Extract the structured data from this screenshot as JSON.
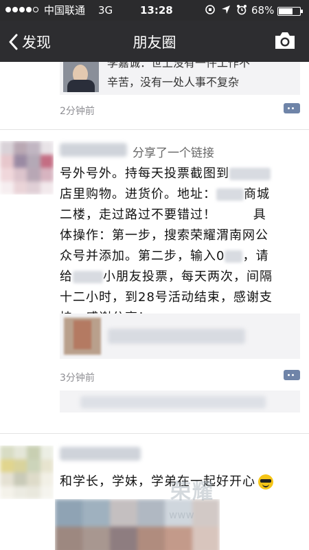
{
  "status_bar": {
    "carrier": "中国联通",
    "network": "3G",
    "time": "13:28",
    "battery_percent": "68%",
    "battery_level": 0.68,
    "signal_dots_filled": 4,
    "signal_dots_total": 5
  },
  "nav": {
    "back_label": "发现",
    "title": "朋友圈",
    "camera_icon": "camera-icon"
  },
  "posts": [
    {
      "share_text_line1": "李嘉诚：世上没有一件工作不",
      "share_text_line2": "辛苦，没有一处人事不复杂",
      "time": "2分钟前"
    },
    {
      "share_tag": "分享了一个链接",
      "text_lines": [
        [
          "号外号外。持每天投票截图到",
          "",
          "店里购物。进货价。地址："
        ],
        [
          "",
          "商城"
        ],
        [
          "二楼，走过路过不要错过！",
          "具"
        ],
        [
          "体操作：第一步，搜索荣耀渭南网公"
        ],
        [
          "众号并添加。第二步，输入0",
          "，请"
        ],
        [
          "给",
          "小朋友投票，每天两次，间隔"
        ],
        [
          "十二小时，到28号活动结束，感谢支"
        ],
        [
          "持，感谢分享！"
        ]
      ],
      "time": "3分钟前"
    },
    {
      "text": "和学长，学妹，学弟在一起好开心"
    }
  ],
  "watermark": {
    "text": "荣耀",
    "sub": "www"
  },
  "colors": {
    "nav_bg": "#2d2d30",
    "status_bg": "#2b2b2d",
    "time_text": "#8e8e93",
    "comment_icon": "#6f84a8",
    "card_bg": "#f3f3f5"
  }
}
